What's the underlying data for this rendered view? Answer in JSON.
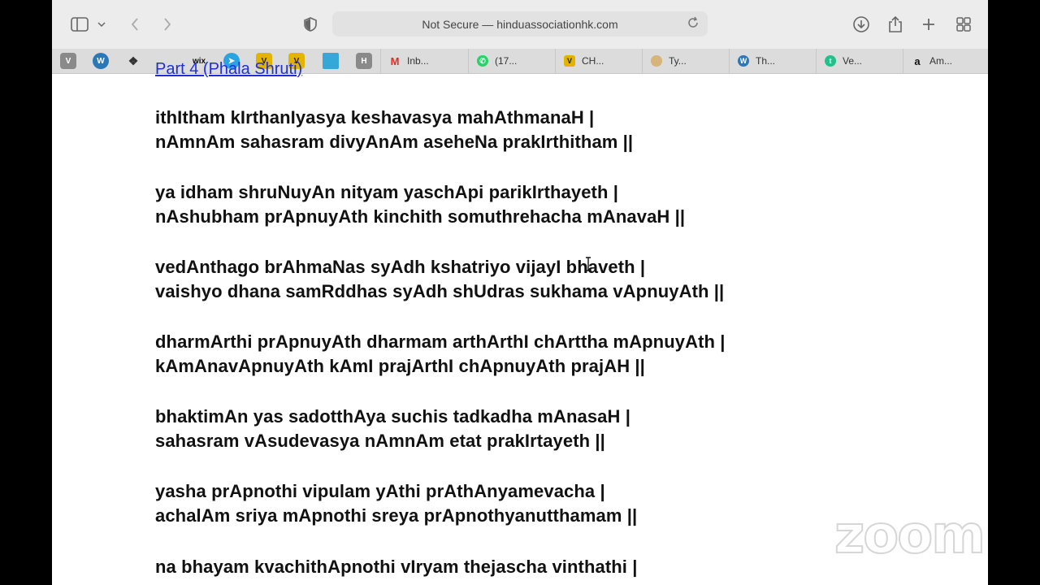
{
  "browser": {
    "address_text": "Not Secure — hinduassociationhk.com",
    "icons": [
      "sidebar-icon",
      "chevron-down-icon",
      "back-icon",
      "forward-icon",
      "shield-icon",
      "reload-icon",
      "download-icon",
      "share-icon",
      "plus-icon",
      "tabs-grid-icon"
    ],
    "pinned_tabs": [
      {
        "label": "V",
        "color": "#8a8a8a"
      },
      {
        "label": "W",
        "color": "#2a78b8"
      },
      {
        "label": "",
        "color": "#333333"
      },
      {
        "label": "wix",
        "color": "#111111"
      },
      {
        "label": "",
        "color": "#2aa3e0"
      },
      {
        "label": "V",
        "color": "#e2b400"
      },
      {
        "label": "V",
        "color": "#e2b400"
      },
      {
        "label": "",
        "color": "#35a8d8"
      },
      {
        "label": "H",
        "color": "#8a8a8a"
      }
    ],
    "tabs": [
      {
        "label": "Inb...",
        "icon": "gmail-icon"
      },
      {
        "label": "(17...",
        "icon": "whatsapp-icon"
      },
      {
        "label": "CH...",
        "icon": "v-icon"
      },
      {
        "label": "Ty...",
        "icon": "ty-icon"
      },
      {
        "label": "Th...",
        "icon": "wordpress-icon"
      },
      {
        "label": "Ve...",
        "icon": "t-icon"
      },
      {
        "label": "Am...",
        "icon": "amazon-icon"
      }
    ]
  },
  "page": {
    "part_link": "Part 4 (Phala Shruti)",
    "verses": [
      [
        "ithItham kIrthanIyasya keshavasya mahAthmanaH |",
        "nAmnAm sahasram divyAnAm aseheNa prakIrthitham ||"
      ],
      [
        "ya idham shruNuyAn nityam yaschApi parikIrthayeth |",
        "nAshubham prApnuyAth kinchith somuthrehacha mAnavaH ||"
      ],
      [
        "vedAnthago brAhmaNas syAdh kshatriyo vijayI bhaveth |",
        "vaishyo dhana samRddhas syAdh shUdras sukhama vApnuyAth ||"
      ],
      [
        "dharmArthi prApnuyAth dharmam arthArthI chArttha mApnuyAth |",
        "kAmAnavApnuyAth kAmI prajArthI chApnuyAth prajAH ||"
      ],
      [
        "bhaktimAn yas sadotthAya suchis tadkadha mAnasaH |",
        "sahasram vAsudevasya nAmnAm etat prakIrtayeth ||"
      ],
      [
        "yasha prApnothi vipulam yAthi prAthAnyamevacha |",
        "achalAm sriya mApnothi sreya prApnothyanutthamam ||"
      ],
      [
        "na bhayam kvachithApnothi vIryam thejascha vinthathi |",
        ""
      ]
    ]
  },
  "overlay": {
    "logo_text": "zoom"
  }
}
